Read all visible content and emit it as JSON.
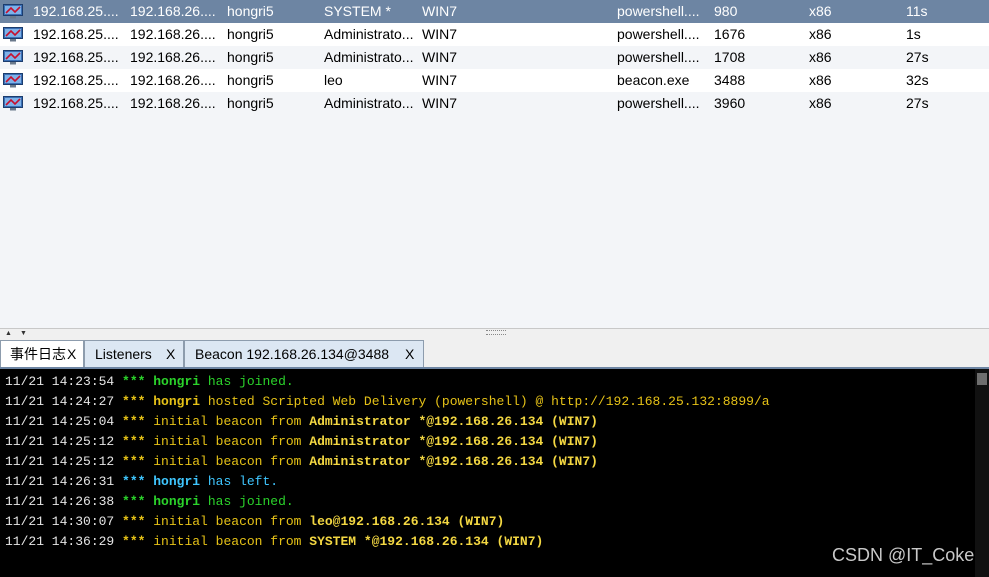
{
  "sessions": [
    {
      "external": "192.168.25....",
      "internal": "192.168.26....",
      "user": "hongri5",
      "computer": "SYSTEM *",
      "note": "WIN7",
      "process": "powershell....",
      "pid": "980",
      "arch": "x86",
      "last": "11s",
      "selected": true
    },
    {
      "external": "192.168.25....",
      "internal": "192.168.26....",
      "user": "hongri5",
      "computer": "Administrato...",
      "note": "WIN7",
      "process": "powershell....",
      "pid": "1676",
      "arch": "x86",
      "last": "1s",
      "selected": false
    },
    {
      "external": "192.168.25....",
      "internal": "192.168.26....",
      "user": "hongri5",
      "computer": "Administrato...",
      "note": "WIN7",
      "process": "powershell....",
      "pid": "1708",
      "arch": "x86",
      "last": "27s",
      "selected": false
    },
    {
      "external": "192.168.25....",
      "internal": "192.168.26....",
      "user": "hongri5",
      "computer": "leo",
      "note": "WIN7",
      "process": "beacon.exe",
      "pid": "3488",
      "arch": "x86",
      "last": "32s",
      "selected": false
    },
    {
      "external": "192.168.25....",
      "internal": "192.168.26....",
      "user": "hongri5",
      "computer": "Administrato...",
      "note": "WIN7",
      "process": "powershell....",
      "pid": "3960",
      "arch": "x86",
      "last": "27s",
      "selected": false
    }
  ],
  "tabs": [
    {
      "label": "事件日志",
      "close": "X",
      "active": true
    },
    {
      "label": "Listeners",
      "close": "X",
      "active": false
    },
    {
      "label": "Beacon 192.168.26.134@3488",
      "close": "X",
      "active": false
    }
  ],
  "event_log": [
    {
      "time": "11/21 14:23:54",
      "stars": "***",
      "who": "hongri",
      "rest": " has joined.",
      "color": "#2bd32b"
    },
    {
      "time": "11/21 14:24:27",
      "stars": "***",
      "who": "hongri",
      "rest": " hosted Scripted Web Delivery (powershell) @ http://192.168.25.132:8899/a",
      "color": "#e6c217"
    },
    {
      "time": "11/21 14:25:04",
      "stars": "***",
      "pre": "initial beacon from ",
      "who": "Administrator *@192.168.26.134 (WIN7)",
      "color": "#e6c217"
    },
    {
      "time": "11/21 14:25:12",
      "stars": "***",
      "pre": "initial beacon from ",
      "who": "Administrator *@192.168.26.134 (WIN7)",
      "color": "#e6c217"
    },
    {
      "time": "11/21 14:25:12",
      "stars": "***",
      "pre": "initial beacon from ",
      "who": "Administrator *@192.168.26.134 (WIN7)",
      "color": "#e6c217"
    },
    {
      "time": "11/21 14:26:31",
      "stars": "***",
      "who": "hongri",
      "rest": " has left.",
      "color": "#3fc6ff"
    },
    {
      "time": "11/21 14:26:38",
      "stars": "***",
      "who": "hongri",
      "rest": " has joined.",
      "color": "#2bd32b"
    },
    {
      "time": "11/21 14:30:07",
      "stars": "***",
      "pre": "initial beacon from ",
      "who": "leo@192.168.26.134 (WIN7)",
      "color": "#e6c217"
    },
    {
      "time": "11/21 14:36:29",
      "stars": "***",
      "pre": "initial beacon from ",
      "who": "SYSTEM *@192.168.26.134 (WIN7)",
      "color": "#e6c217"
    }
  ],
  "watermark": "CSDN @IT_Coke",
  "colors": {
    "selection": "#6d85a3",
    "console_bg": "#000000",
    "joined": "#2bd32b",
    "left": "#3fc6ff",
    "beacon": "#e6c217"
  }
}
